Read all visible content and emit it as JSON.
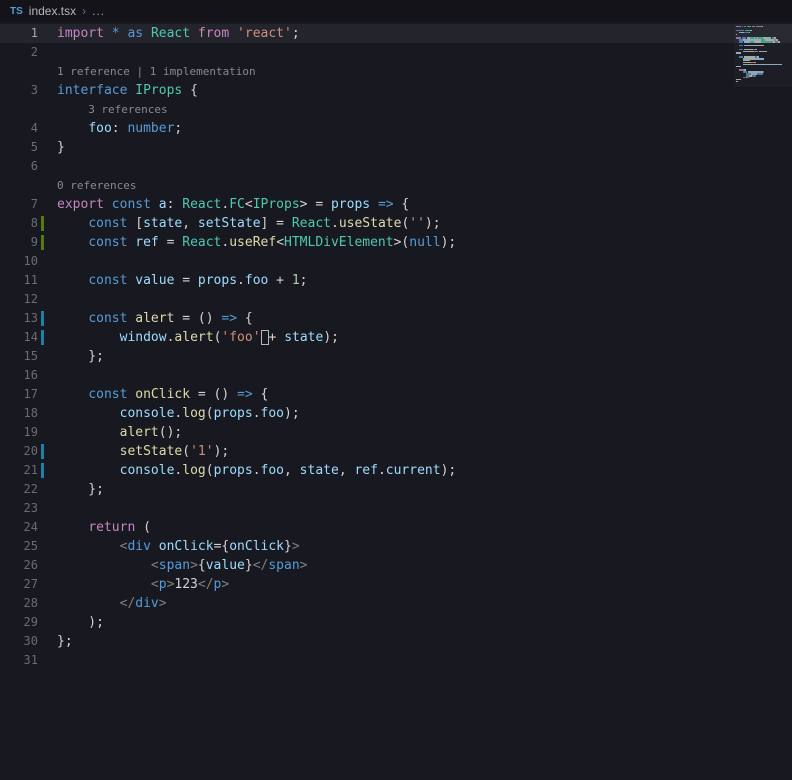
{
  "colors": {
    "k1": "#c586c0",
    "k2": "#569cd6",
    "ty": "#4ec9b0",
    "v": "#9cdcfe",
    "fn": "#dcdcaa",
    "s": "#ce9178",
    "n": "#b5cea8",
    "p": "#d4d4d4",
    "tb": "#808080",
    "tg": "#569cd6",
    "lens": "#8a8a8a",
    "lineNumber": "#6b6b76",
    "lineNumberActive": "#a8a8b2",
    "editorBg": "#181820",
    "topBarBg": "#131319",
    "activeLineBg": "#24242d",
    "gutterAdded": "#587c0c",
    "gutterModified": "#1b81a8"
  },
  "breadcrumb": {
    "file_type": "TS",
    "file_name": "index.tsx",
    "separator": "›",
    "ellipsis": "..."
  },
  "editor": {
    "rows": [
      {
        "type": "line",
        "num": 1,
        "active": true,
        "tokens": [
          [
            "import",
            "k1"
          ],
          [
            " ",
            "p"
          ],
          [
            "*",
            "k2"
          ],
          [
            " ",
            "p"
          ],
          [
            "as",
            "k2"
          ],
          [
            " ",
            "p"
          ],
          [
            "React",
            "ty"
          ],
          [
            " ",
            "p"
          ],
          [
            "from",
            "k1"
          ],
          [
            " ",
            "p"
          ],
          [
            "'react'",
            "s"
          ],
          [
            ";",
            "p"
          ]
        ]
      },
      {
        "type": "line",
        "num": 2,
        "tokens": []
      },
      {
        "type": "lens",
        "text": "1 reference | 1 implementation",
        "indent": 0
      },
      {
        "type": "line",
        "num": 3,
        "tokens": [
          [
            "interface",
            "k2"
          ],
          [
            " ",
            "p"
          ],
          [
            "IProps",
            "ty"
          ],
          [
            " {",
            "p"
          ]
        ]
      },
      {
        "type": "lens",
        "text": "3 references",
        "indent": 4
      },
      {
        "type": "line",
        "num": 4,
        "tokens": [
          [
            "    ",
            "p"
          ],
          [
            "foo",
            "v"
          ],
          [
            ": ",
            "p"
          ],
          [
            "number",
            "k2"
          ],
          [
            ";",
            "p"
          ]
        ]
      },
      {
        "type": "line",
        "num": 5,
        "tokens": [
          [
            "}",
            "p"
          ]
        ]
      },
      {
        "type": "line",
        "num": 6,
        "tokens": []
      },
      {
        "type": "lens",
        "text": "0 references",
        "indent": 0
      },
      {
        "type": "line",
        "num": 7,
        "tokens": [
          [
            "export",
            "k1"
          ],
          [
            " ",
            "p"
          ],
          [
            "const",
            "k2"
          ],
          [
            " ",
            "p"
          ],
          [
            "a",
            "v"
          ],
          [
            ": ",
            "p"
          ],
          [
            "React",
            "ty"
          ],
          [
            ".",
            "p"
          ],
          [
            "FC",
            "ty"
          ],
          [
            "<",
            "p"
          ],
          [
            "IProps",
            "ty"
          ],
          [
            ">",
            "p"
          ],
          [
            " = ",
            "p"
          ],
          [
            "props",
            "v"
          ],
          [
            " ",
            "p"
          ],
          [
            "=>",
            "k2"
          ],
          [
            " {",
            "p"
          ]
        ]
      },
      {
        "type": "line",
        "num": 8,
        "gutter": "added",
        "tokens": [
          [
            "    ",
            "p"
          ],
          [
            "const",
            "k2"
          ],
          [
            " [",
            "p"
          ],
          [
            "state",
            "v"
          ],
          [
            ", ",
            "p"
          ],
          [
            "setState",
            "v"
          ],
          [
            "] = ",
            "p"
          ],
          [
            "React",
            "ty"
          ],
          [
            ".",
            "p"
          ],
          [
            "useState",
            "fn"
          ],
          [
            "(",
            "p"
          ],
          [
            "''",
            "s"
          ],
          [
            ");",
            "p"
          ]
        ]
      },
      {
        "type": "line",
        "num": 9,
        "gutter": "added",
        "tokens": [
          [
            "    ",
            "p"
          ],
          [
            "const",
            "k2"
          ],
          [
            " ",
            "p"
          ],
          [
            "ref",
            "v"
          ],
          [
            " = ",
            "p"
          ],
          [
            "React",
            "ty"
          ],
          [
            ".",
            "p"
          ],
          [
            "useRef",
            "fn"
          ],
          [
            "<",
            "p"
          ],
          [
            "HTMLDivElement",
            "ty"
          ],
          [
            ">(",
            "p"
          ],
          [
            "null",
            "k2"
          ],
          [
            ");",
            "p"
          ]
        ]
      },
      {
        "type": "line",
        "num": 10,
        "tokens": []
      },
      {
        "type": "line",
        "num": 11,
        "tokens": [
          [
            "    ",
            "p"
          ],
          [
            "const",
            "k2"
          ],
          [
            " ",
            "p"
          ],
          [
            "value",
            "v"
          ],
          [
            " = ",
            "p"
          ],
          [
            "props",
            "v"
          ],
          [
            ".",
            "p"
          ],
          [
            "foo",
            "v"
          ],
          [
            " + ",
            "p"
          ],
          [
            "1",
            "n"
          ],
          [
            ";",
            "p"
          ]
        ]
      },
      {
        "type": "line",
        "num": 12,
        "tokens": []
      },
      {
        "type": "line",
        "num": 13,
        "gutter": "modified",
        "tokens": [
          [
            "    ",
            "p"
          ],
          [
            "const",
            "k2"
          ],
          [
            " ",
            "p"
          ],
          [
            "alert",
            "fn"
          ],
          [
            " = () ",
            "p"
          ],
          [
            "=>",
            "k2"
          ],
          [
            " {",
            "p"
          ]
        ]
      },
      {
        "type": "line",
        "num": 14,
        "gutter": "modified",
        "tokens": [
          [
            "        ",
            "p"
          ],
          [
            "window",
            "v"
          ],
          [
            ".",
            "p"
          ],
          [
            "alert",
            "fn"
          ],
          [
            "(",
            "p"
          ],
          [
            "'foo'",
            "s"
          ],
          [
            " ",
            "cur"
          ],
          [
            "+ ",
            "p"
          ],
          [
            "state",
            "v"
          ],
          [
            ");",
            "p"
          ]
        ]
      },
      {
        "type": "line",
        "num": 15,
        "tokens": [
          [
            "    };",
            "p"
          ]
        ]
      },
      {
        "type": "line",
        "num": 16,
        "tokens": []
      },
      {
        "type": "line",
        "num": 17,
        "tokens": [
          [
            "    ",
            "p"
          ],
          [
            "const",
            "k2"
          ],
          [
            " ",
            "p"
          ],
          [
            "onClick",
            "fn"
          ],
          [
            " = () ",
            "p"
          ],
          [
            "=>",
            "k2"
          ],
          [
            " {",
            "p"
          ]
        ]
      },
      {
        "type": "line",
        "num": 18,
        "tokens": [
          [
            "        ",
            "p"
          ],
          [
            "console",
            "v"
          ],
          [
            ".",
            "p"
          ],
          [
            "log",
            "fn"
          ],
          [
            "(",
            "p"
          ],
          [
            "props",
            "v"
          ],
          [
            ".",
            "p"
          ],
          [
            "foo",
            "v"
          ],
          [
            ");",
            "p"
          ]
        ]
      },
      {
        "type": "line",
        "num": 19,
        "tokens": [
          [
            "        ",
            "p"
          ],
          [
            "alert",
            "fn"
          ],
          [
            "();",
            "p"
          ]
        ]
      },
      {
        "type": "line",
        "num": 20,
        "gutter": "modified",
        "tokens": [
          [
            "        ",
            "p"
          ],
          [
            "setState",
            "fn"
          ],
          [
            "(",
            "p"
          ],
          [
            "'1'",
            "s"
          ],
          [
            ");",
            "p"
          ]
        ]
      },
      {
        "type": "line",
        "num": 21,
        "gutter": "modified",
        "tokens": [
          [
            "        ",
            "p"
          ],
          [
            "console",
            "v"
          ],
          [
            ".",
            "p"
          ],
          [
            "log",
            "fn"
          ],
          [
            "(",
            "p"
          ],
          [
            "props",
            "v"
          ],
          [
            ".",
            "p"
          ],
          [
            "foo",
            "v"
          ],
          [
            ", ",
            "p"
          ],
          [
            "state",
            "v"
          ],
          [
            ", ",
            "p"
          ],
          [
            "ref",
            "v"
          ],
          [
            ".",
            "p"
          ],
          [
            "current",
            "v"
          ],
          [
            ");",
            "p"
          ]
        ]
      },
      {
        "type": "line",
        "num": 22,
        "tokens": [
          [
            "    };",
            "p"
          ]
        ]
      },
      {
        "type": "line",
        "num": 23,
        "tokens": []
      },
      {
        "type": "line",
        "num": 24,
        "tokens": [
          [
            "    ",
            "p"
          ],
          [
            "return",
            "k1"
          ],
          [
            " (",
            "p"
          ]
        ]
      },
      {
        "type": "line",
        "num": 25,
        "tokens": [
          [
            "        ",
            "p"
          ],
          [
            "<",
            "tb"
          ],
          [
            "div",
            "tg"
          ],
          [
            " ",
            "p"
          ],
          [
            "onClick",
            "v"
          ],
          [
            "=",
            "p"
          ],
          [
            "{",
            "p"
          ],
          [
            "onClick",
            "v"
          ],
          [
            "}",
            "p"
          ],
          [
            ">",
            "tb"
          ]
        ]
      },
      {
        "type": "line",
        "num": 26,
        "tokens": [
          [
            "            ",
            "p"
          ],
          [
            "<",
            "tb"
          ],
          [
            "span",
            "tg"
          ],
          [
            ">",
            "tb"
          ],
          [
            "{",
            "p"
          ],
          [
            "value",
            "v"
          ],
          [
            "}",
            "p"
          ],
          [
            "</",
            "tb"
          ],
          [
            "span",
            "tg"
          ],
          [
            ">",
            "tb"
          ]
        ]
      },
      {
        "type": "line",
        "num": 27,
        "tokens": [
          [
            "            ",
            "p"
          ],
          [
            "<",
            "tb"
          ],
          [
            "p",
            "tg"
          ],
          [
            ">",
            "tb"
          ],
          [
            "123",
            "p"
          ],
          [
            "</",
            "tb"
          ],
          [
            "p",
            "tg"
          ],
          [
            ">",
            "tb"
          ]
        ]
      },
      {
        "type": "line",
        "num": 28,
        "tokens": [
          [
            "        ",
            "p"
          ],
          [
            "</",
            "tb"
          ],
          [
            "div",
            "tg"
          ],
          [
            ">",
            "tb"
          ]
        ]
      },
      {
        "type": "line",
        "num": 29,
        "tokens": [
          [
            "    );",
            "p"
          ]
        ]
      },
      {
        "type": "line",
        "num": 30,
        "tokens": [
          [
            "};",
            "p"
          ]
        ]
      },
      {
        "type": "line",
        "num": 31,
        "tokens": []
      }
    ]
  }
}
